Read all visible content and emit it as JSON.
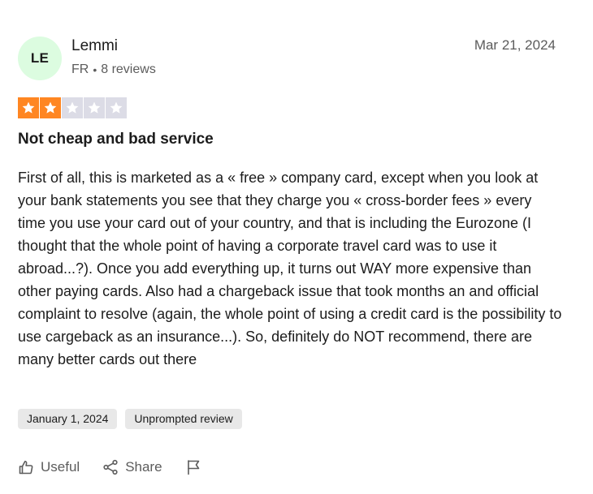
{
  "reviewer": {
    "initials": "LE",
    "name": "Lemmi",
    "country": "FR",
    "review_count": "8 reviews",
    "avatar_color": "#dcfce0"
  },
  "review": {
    "date": "Mar 21, 2024",
    "rating": 2,
    "rating_max": 5,
    "star_color_filled": "#ff8622",
    "star_color_empty": "#dcdce6",
    "title": "Not cheap and bad service",
    "body": "First of all, this is marketed as a « free » company card, except when you look at your bank statements you see that they charge you « cross-border fees » every time you use your card out of your country, and that is including the Eurozone (I thought that the whole point of having a corporate travel card was to use it abroad...?). Once you add everything up, it turns out WAY more expensive than other paying cards. Also had a chargeback issue that took months an and official complaint to resolve (again, the whole point of using a credit card is the possibility to use cargeback as an insurance...). So, definitely do NOT recommend, there are many better cards out there",
    "experience_date": "January 1, 2024",
    "tag": "Unprompted review"
  },
  "actions": {
    "useful_label": "Useful",
    "share_label": "Share",
    "useful_icon": "thumbs-up-icon",
    "share_icon": "share-icon",
    "flag_icon": "flag-icon"
  }
}
